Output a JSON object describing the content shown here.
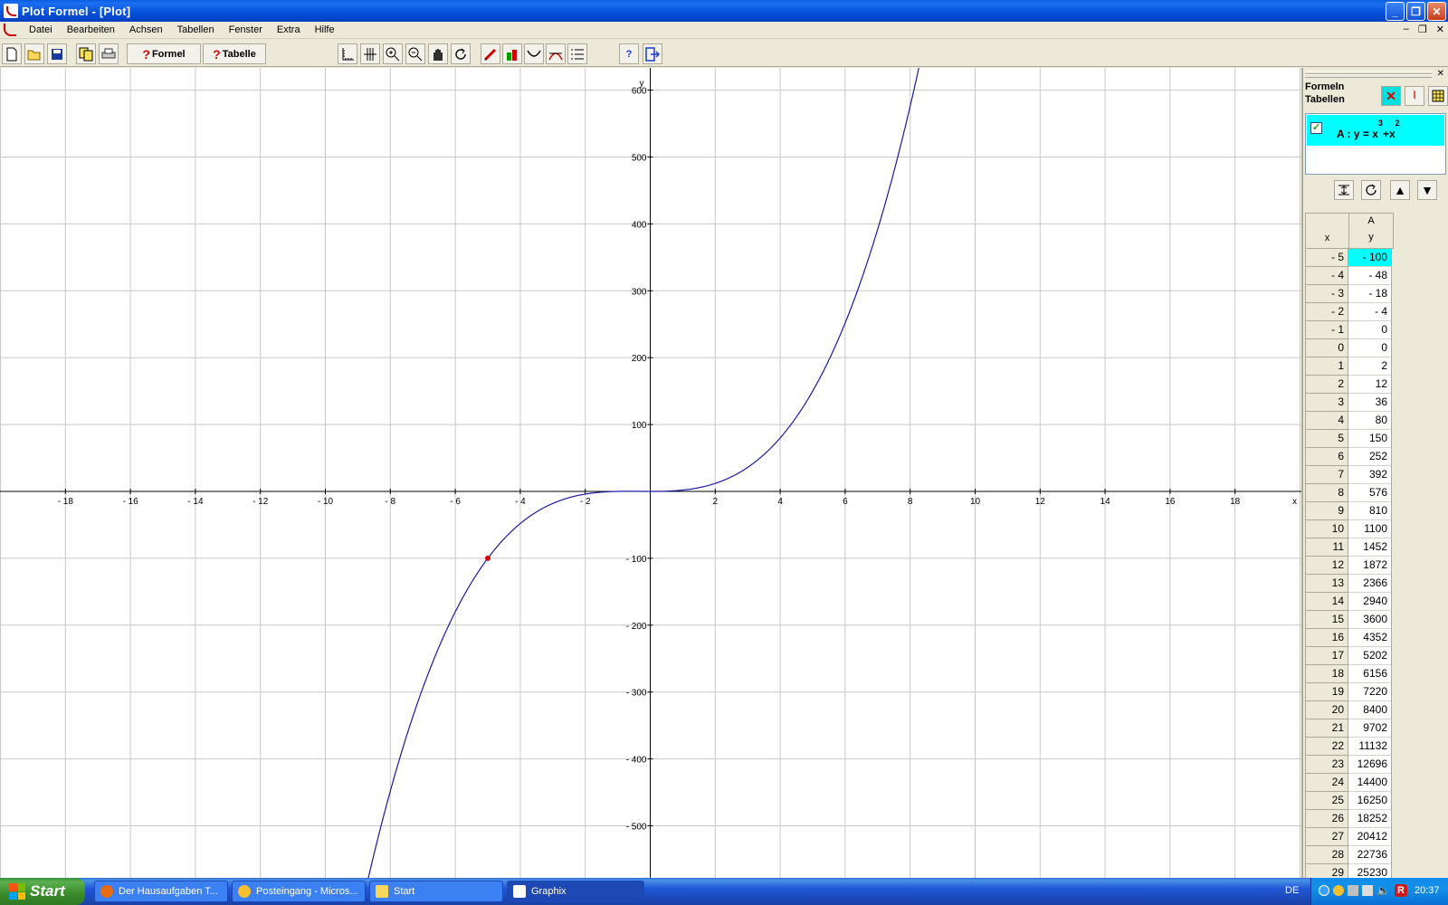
{
  "window": {
    "title": "Plot Formel - [Plot]"
  },
  "menu": [
    "Datei",
    "Bearbeiten",
    "Achsen",
    "Tabellen",
    "Fenster",
    "Extra",
    "Hilfe"
  ],
  "toolbar": {
    "formel_label": "Formel",
    "tabelle_label": "Tabelle",
    "qmark": "?"
  },
  "plot": {
    "x_label": "x",
    "y_label": "y",
    "x_ticks": [
      "- 18",
      "- 16",
      "- 14",
      "- 12",
      "- 10",
      "- 8",
      "- 6",
      "- 4",
      "- 2",
      "2",
      "4",
      "6",
      "8",
      "10",
      "12",
      "14",
      "16",
      "18"
    ],
    "y_ticks": [
      "600",
      "500",
      "400",
      "300",
      "200",
      "100",
      "- 100",
      "- 200",
      "- 300",
      "- 400",
      "- 500"
    ],
    "curve_color": "#1a1aa0",
    "marker": {
      "x": -5,
      "y": -100,
      "color": "#d00000"
    }
  },
  "chart_data": {
    "type": "line",
    "series": [
      {
        "name": "A : y = x³ + x²",
        "function": "x^3 + x^2"
      }
    ],
    "xlim": [
      -20,
      20
    ],
    "ylim": [
      -600,
      600
    ],
    "x_tick_values": [
      -18,
      -16,
      -14,
      -12,
      -10,
      -8,
      -6,
      -4,
      -2,
      2,
      4,
      6,
      8,
      10,
      12,
      14,
      16,
      18
    ],
    "y_tick_values": [
      600,
      500,
      400,
      300,
      200,
      100,
      -100,
      -200,
      -300,
      -400,
      -500
    ],
    "grid": true,
    "highlight_point": {
      "x": -5,
      "y": -100
    }
  },
  "panel": {
    "header_line1": "Formeln",
    "header_line2": "Tabellen",
    "formula_prefix": "A : y = x",
    "formula_exp1": "3",
    "formula_mid": "+x",
    "formula_exp2": "2",
    "formula_checked": "✓",
    "table_head_x": "x",
    "table_head_series": "A",
    "table_head_y": "y",
    "rows": [
      {
        "x": "- 5",
        "y": "- 100",
        "selected": true
      },
      {
        "x": "- 4",
        "y": "- 48"
      },
      {
        "x": "- 3",
        "y": "- 18"
      },
      {
        "x": "- 2",
        "y": "- 4"
      },
      {
        "x": "- 1",
        "y": "0"
      },
      {
        "x": "0",
        "y": "0"
      },
      {
        "x": "1",
        "y": "2"
      },
      {
        "x": "2",
        "y": "12"
      },
      {
        "x": "3",
        "y": "36"
      },
      {
        "x": "4",
        "y": "80"
      },
      {
        "x": "5",
        "y": "150"
      },
      {
        "x": "6",
        "y": "252"
      },
      {
        "x": "7",
        "y": "392"
      },
      {
        "x": "8",
        "y": "576"
      },
      {
        "x": "9",
        "y": "810"
      },
      {
        "x": "10",
        "y": "1100"
      },
      {
        "x": "11",
        "y": "1452"
      },
      {
        "x": "12",
        "y": "1872"
      },
      {
        "x": "13",
        "y": "2366"
      },
      {
        "x": "14",
        "y": "2940"
      },
      {
        "x": "15",
        "y": "3600"
      },
      {
        "x": "16",
        "y": "4352"
      },
      {
        "x": "17",
        "y": "5202"
      },
      {
        "x": "18",
        "y": "6156"
      },
      {
        "x": "19",
        "y": "7220"
      },
      {
        "x": "20",
        "y": "8400"
      },
      {
        "x": "21",
        "y": "9702"
      },
      {
        "x": "22",
        "y": "11132"
      },
      {
        "x": "23",
        "y": "12696"
      },
      {
        "x": "24",
        "y": "14400"
      },
      {
        "x": "25",
        "y": "16250"
      },
      {
        "x": "26",
        "y": "18252"
      },
      {
        "x": "27",
        "y": "20412"
      },
      {
        "x": "28",
        "y": "22736"
      },
      {
        "x": "29",
        "y": "25230"
      }
    ]
  },
  "taskbar": {
    "start_label": "Start",
    "tasks": [
      {
        "label": "Der Hausaufgaben T...",
        "icon": "firefox-icon"
      },
      {
        "label": "Posteingang - Micros...",
        "icon": "outlook-icon"
      },
      {
        "label": "Start",
        "icon": "folder-icon"
      },
      {
        "label": "Graphix",
        "icon": "graphix-icon"
      }
    ],
    "lang": "DE",
    "clock": "20:37"
  }
}
